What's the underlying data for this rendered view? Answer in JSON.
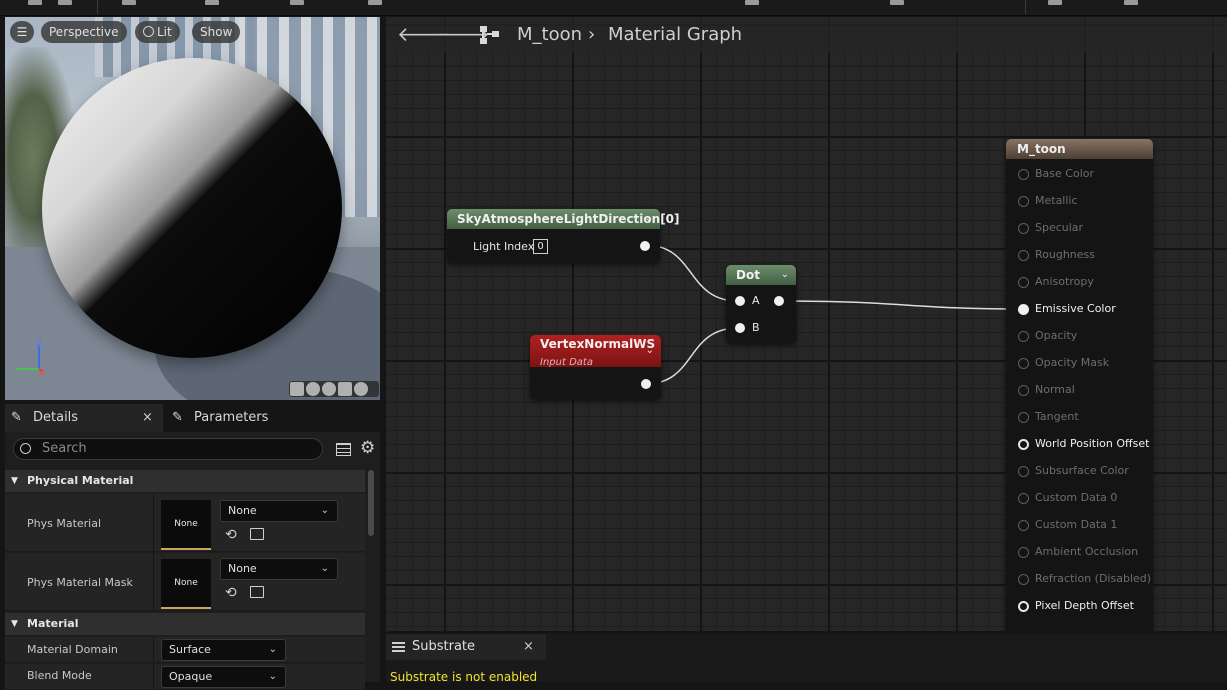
{
  "viewport": {
    "perspective_label": "Perspective",
    "lit_label": "Lit",
    "show_label": "Show",
    "axis_z": "Z",
    "axis_x": "X"
  },
  "details": {
    "tab_details": "Details",
    "tab_parameters": "Parameters",
    "search_placeholder": "Search",
    "section_physical": "Physical Material",
    "phys_material_label": "Phys Material",
    "phys_material_thumb": "None",
    "phys_material_value": "None",
    "phys_mask_label": "Phys Material Mask",
    "phys_mask_thumb": "None",
    "phys_mask_value": "None",
    "section_material": "Material",
    "domain_label": "Material Domain",
    "domain_value": "Surface",
    "blend_label": "Blend Mode",
    "blend_value": "Opaque"
  },
  "graph": {
    "breadcrumb_asset": "M_toon",
    "breadcrumb_sep": "›",
    "breadcrumb_page": "Material Graph",
    "sky_node": {
      "title": "SkyAtmosphereLightDirection[0]",
      "param_label": "Light Index",
      "param_value": "0"
    },
    "vertex_node": {
      "title": "VertexNormalWS",
      "subtitle": "Input Data"
    },
    "dot_node": {
      "title": "Dot",
      "pin_a": "A",
      "pin_b": "B"
    },
    "result_node": {
      "title": "M_toon",
      "inputs": [
        {
          "label": "Base Color",
          "state": "off"
        },
        {
          "label": "Metallic",
          "state": "off"
        },
        {
          "label": "Specular",
          "state": "off"
        },
        {
          "label": "Roughness",
          "state": "off"
        },
        {
          "label": "Anisotropy",
          "state": "off"
        },
        {
          "label": "Emissive Color",
          "state": "connected"
        },
        {
          "label": "Opacity",
          "state": "off"
        },
        {
          "label": "Opacity Mask",
          "state": "off"
        },
        {
          "label": "Normal",
          "state": "off"
        },
        {
          "label": "Tangent",
          "state": "off"
        },
        {
          "label": "World Position Offset",
          "state": "active"
        },
        {
          "label": "Subsurface Color",
          "state": "off"
        },
        {
          "label": "Custom Data 0",
          "state": "off"
        },
        {
          "label": "Custom Data 1",
          "state": "off"
        },
        {
          "label": "Ambient Occlusion",
          "state": "off"
        },
        {
          "label": "Refraction (Disabled)",
          "state": "off"
        },
        {
          "label": "Pixel Depth Offset",
          "state": "active"
        }
      ]
    }
  },
  "substrate": {
    "tab_label": "Substrate",
    "message": "Substrate is not enabled"
  },
  "colors": {
    "accent_blue": "#3a8ee6",
    "sky_header": "#4d6a4d",
    "vertex_header": "#9a1c1c",
    "result_header": "#6e5a4a",
    "warning_text": "#f2e22a"
  }
}
